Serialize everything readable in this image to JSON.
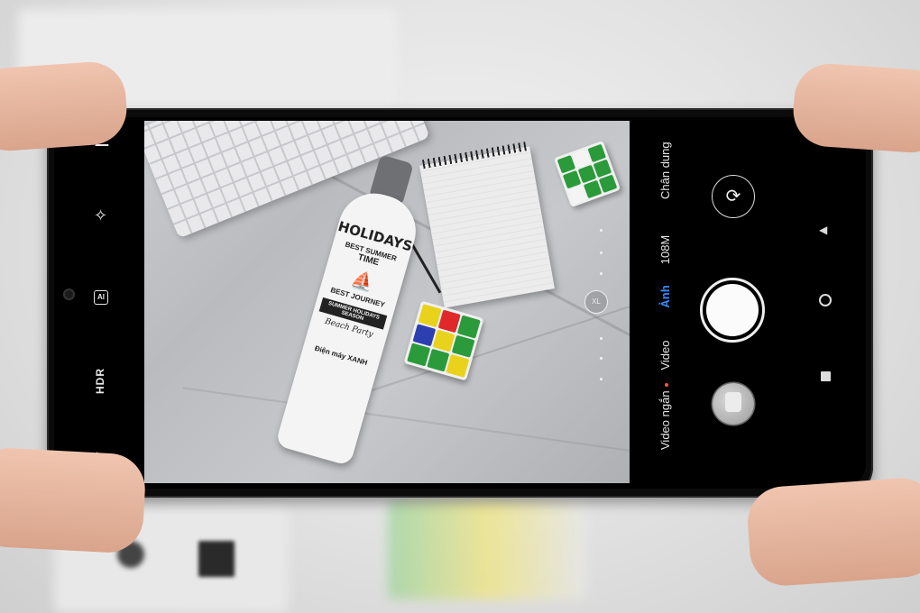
{
  "left_toolbar": {
    "menu_icon": "menu-icon",
    "effects_icon": "sparkle-icon",
    "ai_label": "AI",
    "hdr_label": "HDR",
    "flash_icon": "flash-auto-icon"
  },
  "viewfinder": {
    "bottle": {
      "title": "HOLIDAYS",
      "line1": "BEST SUMMER",
      "line2": "TIME",
      "line3": "BEST JOURNEY",
      "band": "SUMMER HOLIDAYS SEASON",
      "line4": "Beach Party",
      "brand": "Điện máy XANH"
    },
    "zoom_badge": "XL"
  },
  "modes": {
    "items": [
      "Chân dung",
      "108M",
      "Ảnh",
      "Video",
      "Video ngắn"
    ],
    "active": "Ảnh"
  },
  "controls": {
    "switch_icon": "camera-switch-icon",
    "shutter_icon": "shutter-button",
    "gallery_icon": "gallery-thumbnail"
  },
  "nav": {
    "back_icon": "back-triangle-icon",
    "home_icon": "home-circle-icon",
    "recent_icon": "recent-square-icon"
  },
  "colors": {
    "active_mode": "#3a8bff",
    "record_dot": "#ff5533"
  }
}
